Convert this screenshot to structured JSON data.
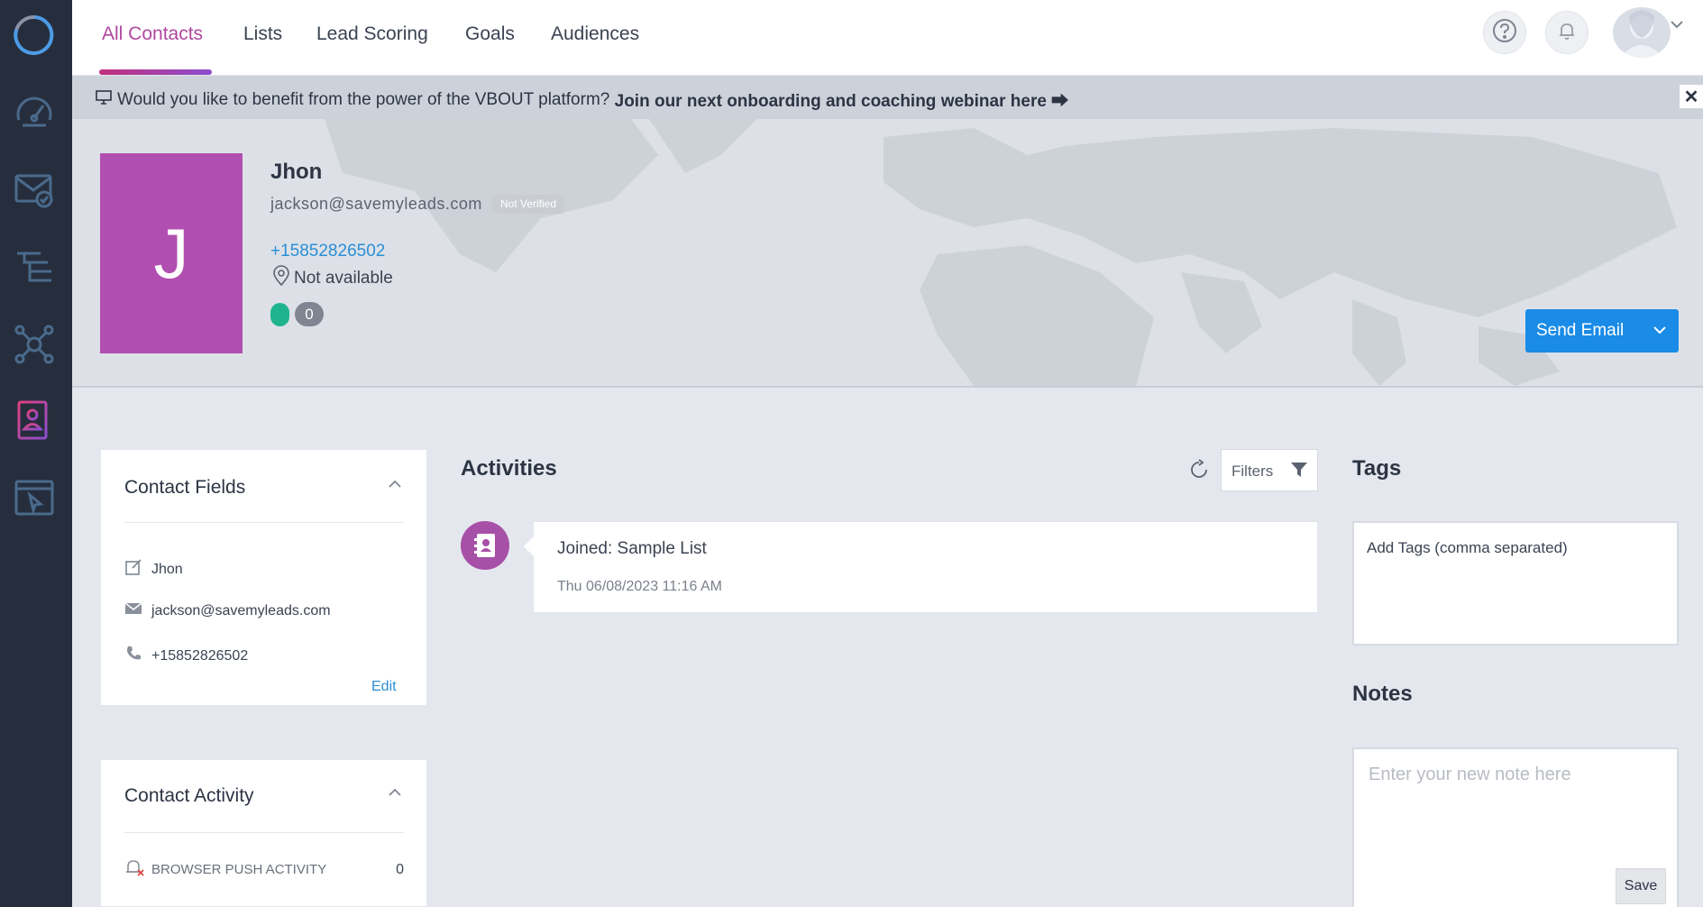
{
  "nav": {
    "tabs": [
      {
        "label": "All Contacts"
      },
      {
        "label": "Lists"
      },
      {
        "label": "Lead Scoring"
      },
      {
        "label": "Goals"
      },
      {
        "label": "Audiences"
      }
    ],
    "help_icon": "question-circle-icon",
    "notifications_icon": "bell-icon"
  },
  "banner": {
    "text": "Would you like to benefit from the power of the VBOUT platform?",
    "link": "Join our next onboarding and coaching webinar here ⮕",
    "close": "✕"
  },
  "contact": {
    "initial": "J",
    "name": "Jhon",
    "email": "jackson@savemyleads.com",
    "verification": "Not Verified",
    "phone": "+15852826502",
    "location": "Not available",
    "score": "0",
    "status_color": "#1fb48d"
  },
  "send_email": {
    "label": "Send Email"
  },
  "contact_fields": {
    "title": "Contact Fields",
    "rows": [
      {
        "value": "Jhon",
        "icon": "edit-icon"
      },
      {
        "value": "jackson@savemyleads.com",
        "icon": "envelope-icon"
      },
      {
        "value": "+15852826502",
        "icon": "phone-icon"
      }
    ],
    "edit_label": "Edit"
  },
  "contact_activity": {
    "title": "Contact Activity",
    "rows": [
      {
        "label": "BROWSER PUSH ACTIVITY",
        "count": "0"
      }
    ]
  },
  "activities": {
    "title": "Activities",
    "filters_label": "Filters",
    "items": [
      {
        "text": "Joined: Sample List",
        "date": "Thu 06/08/2023 11:16 AM"
      }
    ]
  },
  "tags": {
    "title": "Tags",
    "placeholder": "Add Tags (comma separated)"
  },
  "notes": {
    "title": "Notes",
    "placeholder": "Enter your new note here",
    "save_label": "Save"
  },
  "colors": {
    "sidebar": "#262e3d",
    "accent": "#b0479f",
    "primary": "#1a8be6",
    "avatar_bg": "#b14fb0"
  }
}
